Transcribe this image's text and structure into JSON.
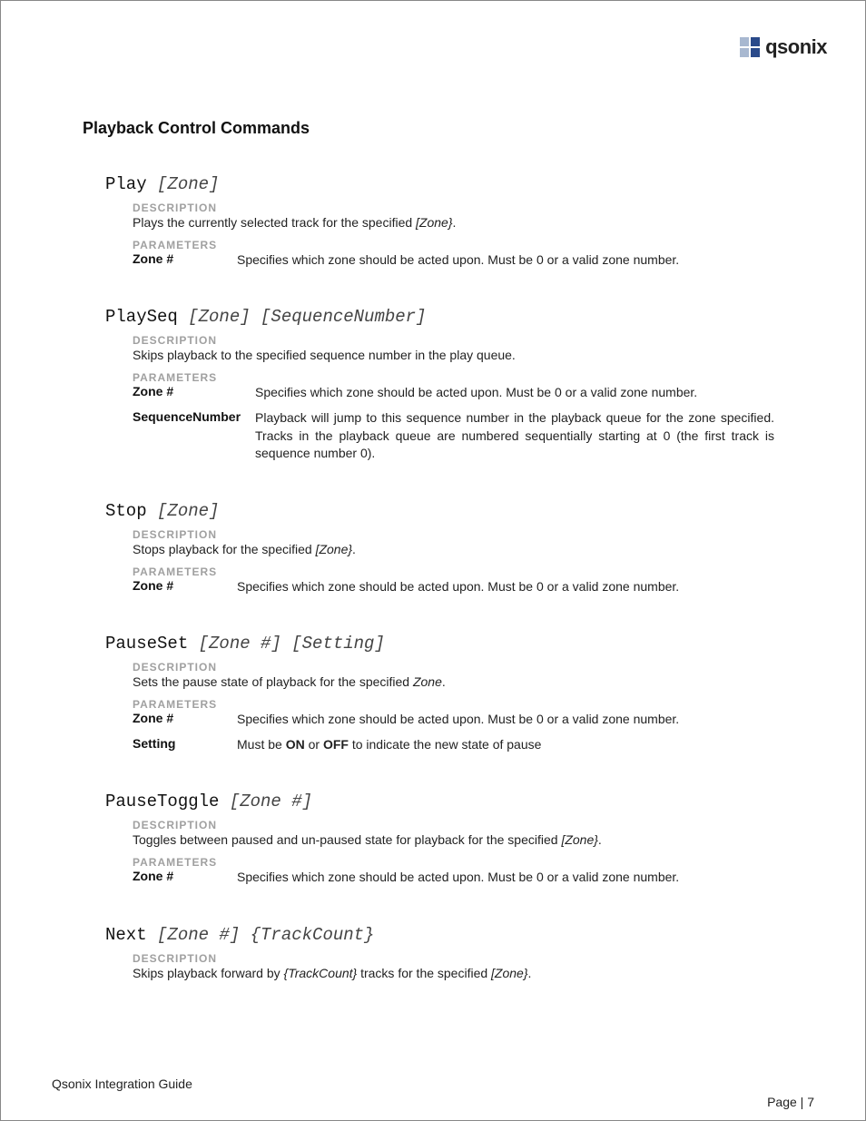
{
  "brand": "qsonix",
  "section_title": "Playback Control Commands",
  "labels": {
    "description": "DESCRIPTION",
    "parameters": "PARAMETERS"
  },
  "commands": [
    {
      "name": "Play",
      "args": "[Zone]",
      "description_pre": "Plays the currently selected track for the specified ",
      "description_ital": "[Zone}",
      "description_post": ".",
      "params": [
        {
          "name": "Zone #",
          "desc": "Specifies which zone should be acted upon.  Must be 0 or a valid zone number."
        }
      ]
    },
    {
      "name": "PlaySeq",
      "args": "[Zone] [SequenceNumber]",
      "description_pre": "Skips playback to the specified sequence number in the play queue.",
      "description_ital": "",
      "description_post": "",
      "params": [
        {
          "name": "Zone #",
          "desc": "Specifies which zone should be acted upon.  Must be 0 or a valid zone number.",
          "wide": true
        },
        {
          "name": "SequenceNumber",
          "desc": "Playback will jump to this sequence number in the playback queue for the zone specified. Tracks in the playback queue are numbered sequentially starting at 0 (the first track is sequence number 0).",
          "wide": true
        }
      ]
    },
    {
      "name": "Stop",
      "args": "[Zone]",
      "description_pre": "Stops playback for the specified ",
      "description_ital": "[Zone}",
      "description_post": ".",
      "params": [
        {
          "name": "Zone #",
          "desc": "Specifies which zone should be acted upon.  Must be 0 or a valid zone number."
        }
      ]
    },
    {
      "name": "PauseSet",
      "args": "[Zone #] [Setting]",
      "description_pre": "Sets the pause state of playback for the specified ",
      "description_ital": "Zone",
      "description_post": ".",
      "params": [
        {
          "name": "Zone #",
          "desc": "Specifies which zone should be acted upon.  Must be 0 or a valid zone number."
        },
        {
          "name": "Setting",
          "desc_parts": [
            {
              "t": "Must be ",
              "b": false
            },
            {
              "t": "ON",
              "b": true
            },
            {
              "t": " or ",
              "b": false
            },
            {
              "t": "OFF",
              "b": true
            },
            {
              "t": " to indicate the new state of pause",
              "b": false
            }
          ]
        }
      ]
    },
    {
      "name": "PauseToggle",
      "args": "[Zone #]",
      "description_pre": "Toggles between paused and un-paused state for playback for the specified ",
      "description_ital": "[Zone}",
      "description_post": ".",
      "params": [
        {
          "name": "Zone #",
          "desc": "Specifies which zone should be acted upon.  Must be 0 or a valid zone number."
        }
      ]
    },
    {
      "name": "Next",
      "args": "[Zone #] {TrackCount}",
      "description_pre": "Skips playback forward by ",
      "description_ital": "{TrackCount}",
      "description_mid": " tracks for the specified ",
      "description_ital2": "[Zone}",
      "description_post": ".",
      "params": []
    }
  ],
  "footer": {
    "title": "Qsonix Integration Guide",
    "page": "Page | 7"
  }
}
